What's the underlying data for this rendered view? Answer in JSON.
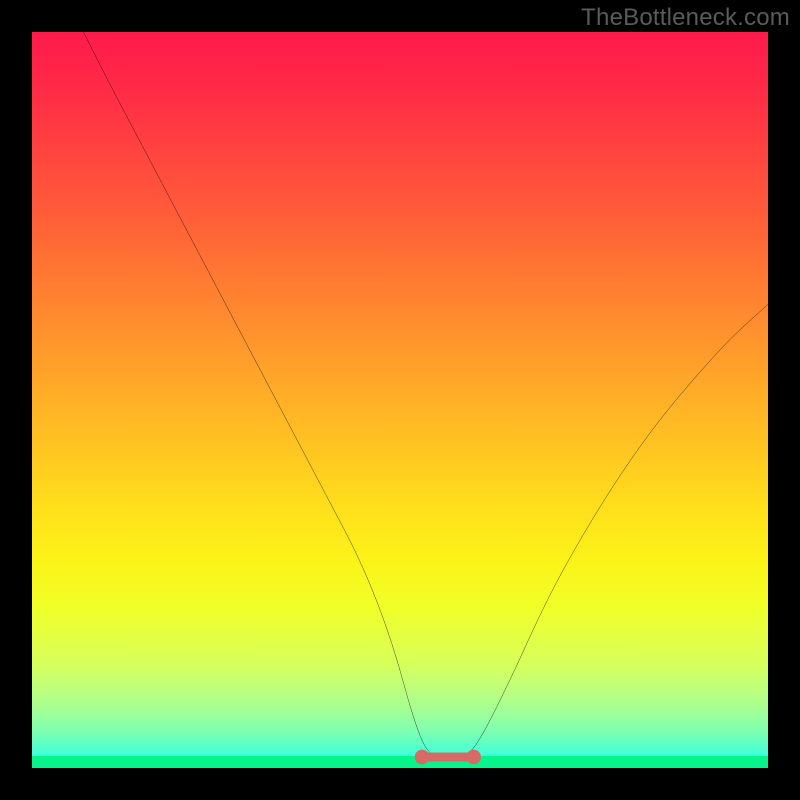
{
  "watermark": "TheBottleneck.com",
  "chart_data": {
    "type": "line",
    "title": "",
    "xlabel": "",
    "ylabel": "",
    "xlim": [
      0,
      100
    ],
    "ylim": [
      0,
      100
    ],
    "series": [
      {
        "name": "curve",
        "x": [
          7,
          10,
          15,
          20,
          25,
          30,
          35,
          40,
          45,
          49,
          52,
          54,
          57,
          59,
          61,
          65,
          70,
          75,
          80,
          85,
          90,
          95,
          100
        ],
        "y": [
          100,
          94,
          84.5,
          75,
          65.5,
          56,
          46.5,
          37,
          27.5,
          17,
          6,
          1.5,
          1.5,
          1.5,
          4,
          12,
          23,
          32,
          40,
          47,
          53,
          58.5,
          63
        ]
      }
    ],
    "flat_segment": {
      "x_start": 53,
      "x_end": 60,
      "y": 1.5,
      "color": "#d86a66",
      "endpoint_radius_pct": 1.0,
      "stroke_width_pct": 1.2
    },
    "background_gradient": {
      "direction": "vertical",
      "stops": [
        {
          "pos": 0.0,
          "color": "#ff1a4b"
        },
        {
          "pos": 0.5,
          "color": "#ffb024"
        },
        {
          "pos": 0.78,
          "color": "#f1ff28"
        },
        {
          "pos": 1.0,
          "color": "#06f58a"
        }
      ]
    }
  }
}
